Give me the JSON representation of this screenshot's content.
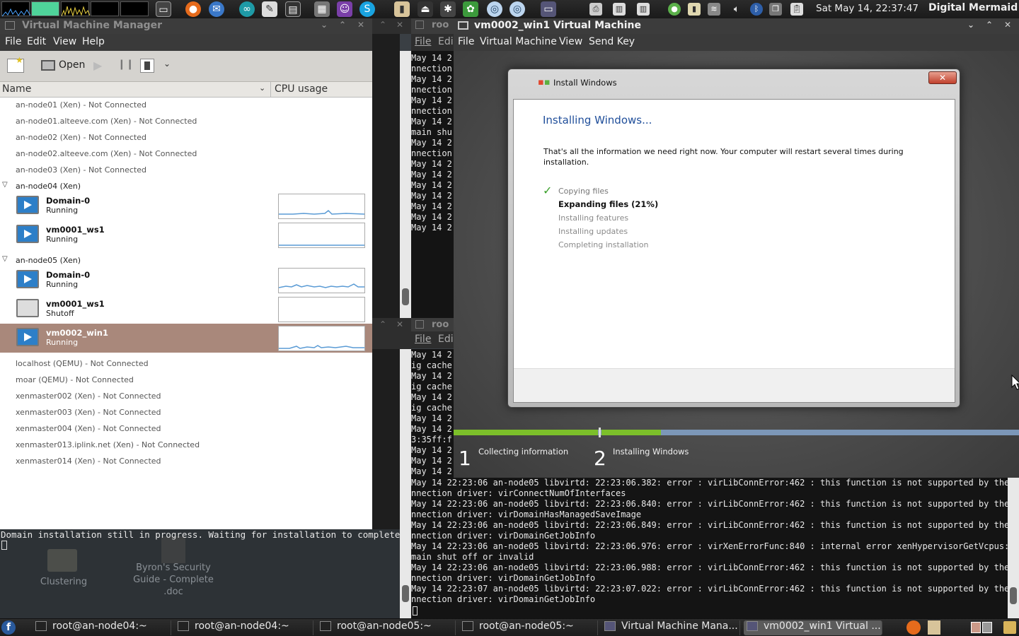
{
  "top_panel": {
    "clock": "Sat May 14, 22:37:47",
    "user": "Digital Mermaid",
    "launchers": [
      "terminal-icon",
      "firefox-icon",
      "thunderbird-icon",
      "arduino-icon",
      "text-editor-icon",
      "console-icon",
      "calculator-icon",
      "pidgin-icon",
      "skype-icon",
      "usb-icon",
      "eject-icon",
      "bug-icon",
      "photos-icon",
      "network-icon",
      "network-icon",
      "computer-icon"
    ],
    "tray": [
      "print-icon",
      "display-icon",
      "display-icon",
      "globe-icon",
      "battery-icon",
      "network-icon",
      "volume-icon",
      "bluetooth-icon",
      "windows-icon",
      "clipboard-icon"
    ]
  },
  "vmm": {
    "title": "Virtual Machine Manager",
    "menu": [
      "File",
      "Edit",
      "View",
      "Help"
    ],
    "toolbar": {
      "open_label": "Open"
    },
    "columns": {
      "name": "Name",
      "cpu": "CPU usage"
    },
    "hosts_top": [
      "an-node01 (Xen) - Not Connected",
      "an-node01.alteeve.com (Xen) - Not Connected",
      "an-node02 (Xen) - Not Connected",
      "an-node02.alteeve.com (Xen) - Not Connected",
      "an-node03 (Xen) - Not Connected"
    ],
    "host4": {
      "name": "an-node04 (Xen)",
      "vms": [
        {
          "name": "Domain-0",
          "status": "Running"
        },
        {
          "name": "vm0001_ws1",
          "status": "Running"
        }
      ]
    },
    "host5": {
      "name": "an-node05 (Xen)",
      "vms": [
        {
          "name": "Domain-0",
          "status": "Running"
        },
        {
          "name": "vm0001_ws1",
          "status": "Shutoff"
        },
        {
          "name": "vm0002_win1",
          "status": "Running"
        }
      ]
    },
    "hosts_bottom": [
      "localhost (QEMU) - Not Connected",
      "moar (QEMU) - Not Connected",
      "xenmaster002 (Xen) - Not Connected",
      "xenmaster003 (Xen) - Not Connected",
      "xenmaster004 (Xen) - Not Connected",
      "xenmaster013.iplink.net (Xen) - Not Connected",
      "xenmaster014 (Xen) - Not Connected"
    ]
  },
  "status_terminal": {
    "line": "Domain installation still in progress. Waiting for installation to complete."
  },
  "desktop": {
    "folder_label": "Clustering",
    "doc_label_1": "Byron's Security",
    "doc_label_2": "Guide - Complete",
    "doc_label_3": ".doc"
  },
  "terminals": {
    "upper": {
      "title": "roo",
      "menu_file": "File",
      "menu_edit": "Edi",
      "lines": [
        "May 14 2",
        "nnection",
        "May 14 2",
        "nnection",
        "May 14 2",
        "nnection",
        "May 14 2",
        "main shu",
        "May 14 2",
        "nnection",
        "May 14 2",
        "May 14 2",
        "May 14 2",
        "May 14 2",
        "May 14 2",
        "May 14 2",
        "May 14 2"
      ]
    },
    "lower": {
      "title": "roo",
      "menu_file": "File",
      "menu_edit": "Edi",
      "lines_top": [
        "May 14 2",
        "ig cache",
        "May 14 2",
        "ig cache",
        "May 14 2",
        "ig cache",
        "May 14 2",
        "May 14 2",
        "3:35ff:f",
        "May 14 2",
        "May 14 2",
        "May 14 2"
      ],
      "lines_full": [
        "May 14 22:23:06 an-node05 libvirtd: 22:23:06.382: error : virLibConnError:462 : this function is not supported by the co",
        "nnection driver: virConnectNumOfInterfaces",
        "May 14 22:23:06 an-node05 libvirtd: 22:23:06.840: error : virLibConnError:462 : this function is not supported by the co",
        "nnection driver: virDomainHasManagedSaveImage",
        "May 14 22:23:06 an-node05 libvirtd: 22:23:06.849: error : virLibConnError:462 : this function is not supported by the co",
        "nnection driver: virDomainGetJobInfo",
        "May 14 22:23:06 an-node05 libvirtd: 22:23:06.976: error : virXenErrorFunc:840 : internal error xenHypervisorGetVcpus: do",
        "main shut off or invalid",
        "May 14 22:23:06 an-node05 libvirtd: 22:23:06.988: error : virLibConnError:462 : this function is not supported by the co",
        "nnection driver: virDomainGetJobInfo",
        "May 14 22:23:07 an-node05 libvirtd: 22:23:07.022: error : virLibConnError:462 : this function is not supported by the co",
        "nnection driver: virDomainGetJobInfo"
      ]
    }
  },
  "viewer": {
    "title": "vm0002_win1 Virtual Machine",
    "menu": [
      "File",
      "Virtual Machine",
      "View",
      "Send Key"
    ]
  },
  "installer": {
    "window_title": "Install Windows",
    "heading": "Installing Windows...",
    "message": "That's all the information we need right now. Your computer will restart several times during installation.",
    "steps": [
      "Copying files",
      "Expanding files (21%)",
      "Installing features",
      "Installing updates",
      "Completing installation"
    ],
    "expanding_progress_percent": 21,
    "stages": [
      {
        "num": "1",
        "label": "Collecting information"
      },
      {
        "num": "2",
        "label": "Installing Windows"
      }
    ]
  },
  "taskbar": {
    "tasks": [
      "root@an-node04:~",
      "root@an-node04:~",
      "root@an-node05:~",
      "root@an-node05:~",
      "Virtual Machine Mana...",
      "vm0002_win1 Virtual ..."
    ]
  },
  "colors": {
    "selection": "#a9887b",
    "install_heading": "#1f4e9a",
    "progress_green": "#7cbf2a",
    "progress_blue": "#7c97b8"
  }
}
